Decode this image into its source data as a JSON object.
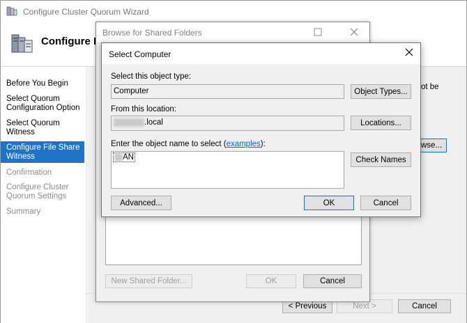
{
  "wizard": {
    "title": "Configure Cluster Quorum Wizard",
    "heading": "Configure F",
    "nav": [
      {
        "label": "Before You Begin",
        "state": "normal"
      },
      {
        "label": "Select Quorum Configuration Option",
        "state": "normal"
      },
      {
        "label": "Select Quorum Witness",
        "state": "normal"
      },
      {
        "label": "Configure File Share Witness",
        "state": "active"
      },
      {
        "label": "Confirmation",
        "state": "disabled"
      },
      {
        "label": "Configure Cluster Quorum Settings",
        "state": "disabled"
      },
      {
        "label": "Summary",
        "state": "disabled"
      }
    ],
    "partial_text": "ot be",
    "partial_browse_btn": "wse...",
    "buttons": {
      "previous": "< Previous",
      "next": "Next >",
      "cancel": "Cancel"
    }
  },
  "browse": {
    "title": "Browse for Shared Folders",
    "buttons": {
      "new_folder": "New Shared Folder...",
      "ok": "OK",
      "cancel": "Cancel"
    }
  },
  "select": {
    "title": "Select Computer",
    "object_type_label": "Select this object type:",
    "object_type_value": "Computer",
    "object_types_button": "Object Types...",
    "location_label": "From this location:",
    "location_value_suffix": ".local",
    "locations_button": "Locations...",
    "enter_label_prefix": "Enter the object name to select (",
    "enter_label_link": "examples",
    "enter_label_suffix": "):",
    "object_name_suffix": "AN",
    "check_names_button": "Check Names",
    "advanced_button": "Advanced...",
    "ok_button": "OK",
    "cancel_button": "Cancel"
  },
  "colors": {
    "accent": "#1f74c9",
    "link": "#0066cc",
    "focus_border": "#0078d7"
  }
}
